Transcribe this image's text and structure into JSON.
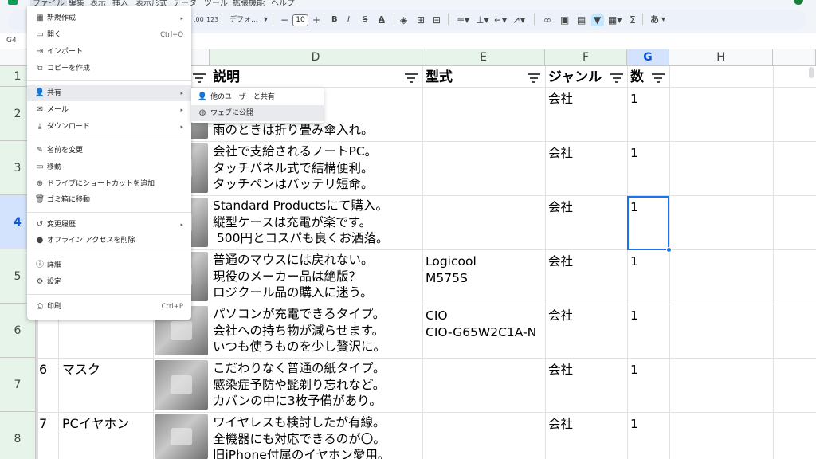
{
  "menubar": {
    "items": [
      "ファイル",
      "編集",
      "表示",
      "挿入",
      "表示形式",
      "データ",
      "ツール",
      "拡張機能",
      "ヘルプ"
    ]
  },
  "toolbar": {
    "percent_fmt": "%",
    "decimal_less": ".0",
    "decimal_more": ".00",
    "number_fmt": "123",
    "font_name": "デフォ...",
    "font_size": "10",
    "bold": "B",
    "italic": "I",
    "strike": "S",
    "text_color": "A",
    "ime": "あ"
  },
  "name_box": "G4",
  "columns": {
    "D": "D",
    "E": "E",
    "F": "F",
    "G": "G",
    "H": "H"
  },
  "rows": [
    "1",
    "2",
    "3",
    "4",
    "5",
    "6",
    "7",
    "8"
  ],
  "headers": {
    "description": "説明",
    "model": "型式",
    "genre": "ジャンル",
    "count": "数"
  },
  "table": [
    {
      "no": "",
      "name": "",
      "desc": "りはなし。\n入れです。\n雨のときは折り畳み傘入れ。",
      "model": "",
      "genre": "会社",
      "count": "1"
    },
    {
      "no": "",
      "name": "",
      "desc": "会社で支給されるノートPC。\nタッチパネル式で結構便利。\nタッチペンはバッテリ短命。",
      "model": "",
      "genre": "会社",
      "count": "1"
    },
    {
      "no": "",
      "name": "",
      "desc": "Standard Productsにて購入。\n縦型ケースは充電が楽です。\n 500円とコスパも良くお洒落。",
      "model": "",
      "genre": "会社",
      "count": "1"
    },
    {
      "no": "",
      "name": "",
      "desc": "普通のマウスには戻れない。\n現役のメーカー品は絶版？\nロジクール品の購入に迷う。",
      "model": "Logicool\nM575S",
      "genre": "会社",
      "count": "1"
    },
    {
      "no": "",
      "name": "",
      "desc": "パソコンが充電できるタイプ。\n会社への持ち物が減らせます。\nいつも使うものを少し贅沢に。",
      "model": "CIO\nCIO-G65W2C1A-N",
      "genre": "会社",
      "count": "1"
    },
    {
      "no": "6",
      "name": "マスク",
      "desc": "こだわりなく普通の紙タイプ。\n感染症予防や髭剃り忘れなど。\nカバンの中に3枚予備があり。",
      "model": "",
      "genre": "会社",
      "count": "1"
    },
    {
      "no": "7",
      "name": "PCイヤホン",
      "desc": "ワイヤレスも検討したが有線。\n全機器にも対応できるのが〇。\n旧iPhone付属のイヤホン愛用。",
      "model": "",
      "genre": "会社",
      "count": "1"
    }
  ],
  "file_menu": {
    "items": [
      {
        "icon": "new-icon",
        "label": "新規作成",
        "submenu": true
      },
      {
        "icon": "folder-icon",
        "label": "開く",
        "shortcut": "Ctrl+O"
      },
      {
        "icon": "import-icon",
        "label": "インポート"
      },
      {
        "icon": "copy-icon",
        "label": "コピーを作成"
      },
      {
        "icon": "share-icon",
        "label": "共有",
        "submenu": true
      },
      {
        "icon": "mail-icon",
        "label": "メール",
        "submenu": true
      },
      {
        "icon": "download-icon",
        "label": "ダウンロード",
        "submenu": true
      },
      {
        "icon": "rename-icon",
        "label": "名前を変更"
      },
      {
        "icon": "move-icon",
        "label": "移動"
      },
      {
        "icon": "shortcut-icon",
        "label": "ドライブにショートカットを追加"
      },
      {
        "icon": "trash-icon",
        "label": "ゴミ箱に移動"
      },
      {
        "icon": "history-icon",
        "label": "変更履歴",
        "submenu": true
      },
      {
        "icon": "offline-icon",
        "label": "オフライン アクセスを削除"
      },
      {
        "icon": "info-icon",
        "label": "詳細"
      },
      {
        "icon": "settings-icon",
        "label": "設定"
      },
      {
        "icon": "print-icon",
        "label": "印刷",
        "shortcut": "Ctrl+P"
      }
    ],
    "arrow": "▸"
  },
  "share_submenu": {
    "items": [
      {
        "icon": "person-add-icon",
        "label": "他のユーザーと共有"
      },
      {
        "icon": "globe-icon",
        "label": "ウェブに公開"
      }
    ]
  },
  "colors": {
    "accent": "#1a73e8",
    "sheets_green": "#0f9d58",
    "hover": "#e8eaed",
    "link": "#1155cc"
  }
}
